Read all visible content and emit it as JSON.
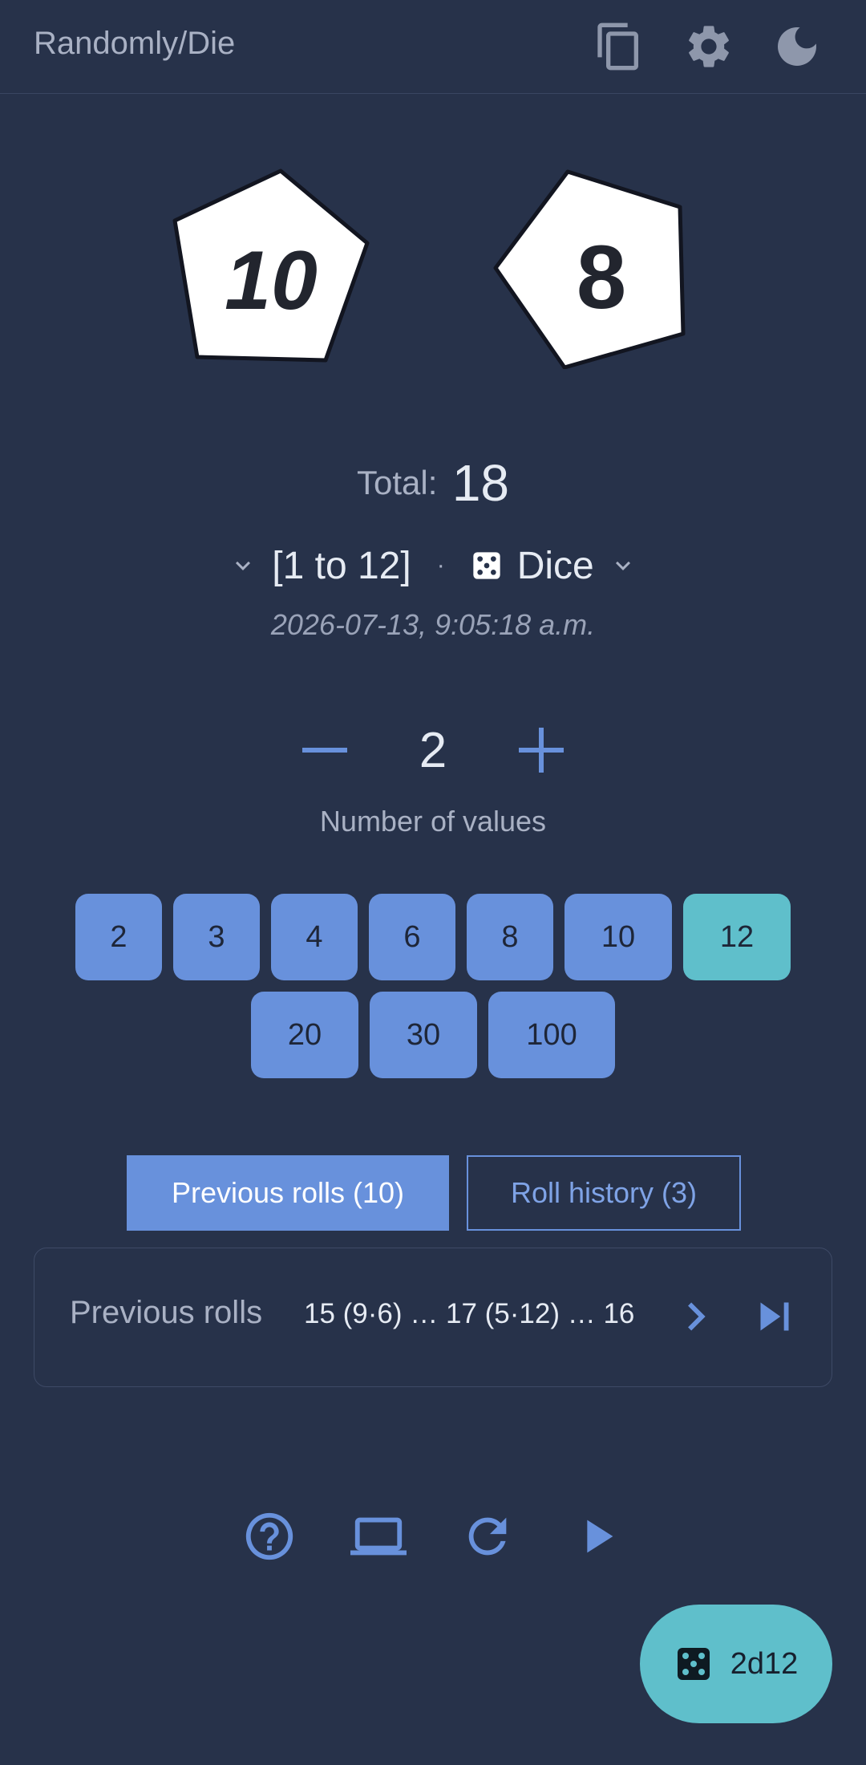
{
  "app": {
    "title": "Randomly/Die"
  },
  "toolbar": {
    "icons": [
      "copy-icon",
      "gear-icon",
      "moon-icon"
    ]
  },
  "dice": [
    {
      "value": "10",
      "shape": "pentagon"
    },
    {
      "value": "8",
      "shape": "pentagon"
    }
  ],
  "result": {
    "total_label": "Total:",
    "total_value": "18"
  },
  "range": {
    "text": "[1 to 12]",
    "separator": "·",
    "type_label": "Dice"
  },
  "timestamp": "2026-07-13, 9:05:18 a.m.",
  "count": {
    "value": "2",
    "label": "Number of values",
    "minus": "−",
    "plus": "+"
  },
  "sides": {
    "options": [
      "2",
      "3",
      "4",
      "6",
      "8",
      "10",
      "12",
      "20",
      "30",
      "100"
    ],
    "selected": "12"
  },
  "tabs": {
    "previous": "Previous rolls (10)",
    "history": "Roll history (3)"
  },
  "previous_rolls": {
    "label": "Previous rolls",
    "items_text": "15 (9·6) … 17 (5·12) … 16 ("
  },
  "bottom_bar": {
    "icons": [
      "help-icon",
      "laptop-icon",
      "refresh-icon",
      "play-icon"
    ]
  },
  "fab": {
    "label": "2d12"
  },
  "colors": {
    "background": "#27324a",
    "accent": "#6891dc",
    "selected": "#5fbfcb",
    "die_face": "#ffffff"
  }
}
